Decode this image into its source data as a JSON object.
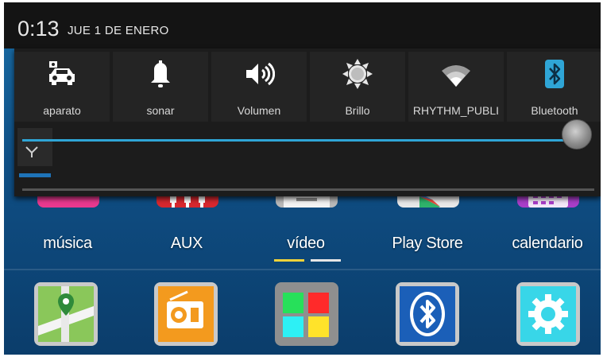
{
  "status": {
    "time": "0:13",
    "date": "JUE 1 DE ENERO"
  },
  "quick_settings": {
    "tiles": [
      {
        "label": "aparato",
        "icon": "car-icon"
      },
      {
        "label": "sonar",
        "icon": "bell-icon"
      },
      {
        "label": "Volumen",
        "icon": "speaker-icon"
      },
      {
        "label": "Brillo",
        "icon": "sun-icon"
      },
      {
        "label": "RHYTHM_PUBLI",
        "icon": "wifi-icon"
      },
      {
        "label": "Bluetooth",
        "icon": "bluetooth-icon"
      }
    ],
    "brightness_level": 0.98
  },
  "apps": [
    {
      "label": "música",
      "icon": "music-icon",
      "color": "#e8398f"
    },
    {
      "label": "AUX",
      "icon": "aux-icon",
      "color": "#d7282f"
    },
    {
      "label": "vídeo",
      "icon": "video-icon",
      "color": "#b9b9b9"
    },
    {
      "label": "Play Store",
      "icon": "play-store-icon",
      "color": "#e8e8e8"
    },
    {
      "label": "calendario",
      "icon": "calendar-icon",
      "color": "#a93ec9"
    }
  ],
  "dock": [
    {
      "icon": "maps-icon",
      "color": "#8ac75a"
    },
    {
      "icon": "radio-icon",
      "color": "#f39a1e"
    },
    {
      "icon": "apps-grid-icon",
      "color": "#9a9a9a"
    },
    {
      "icon": "bluetooth-app-icon",
      "color": "#1b5fb8"
    },
    {
      "icon": "settings-icon",
      "color": "#38d6e8"
    }
  ],
  "colors": {
    "accent": "#2fa5d6",
    "page_indicator_active": "#f0d23a"
  }
}
